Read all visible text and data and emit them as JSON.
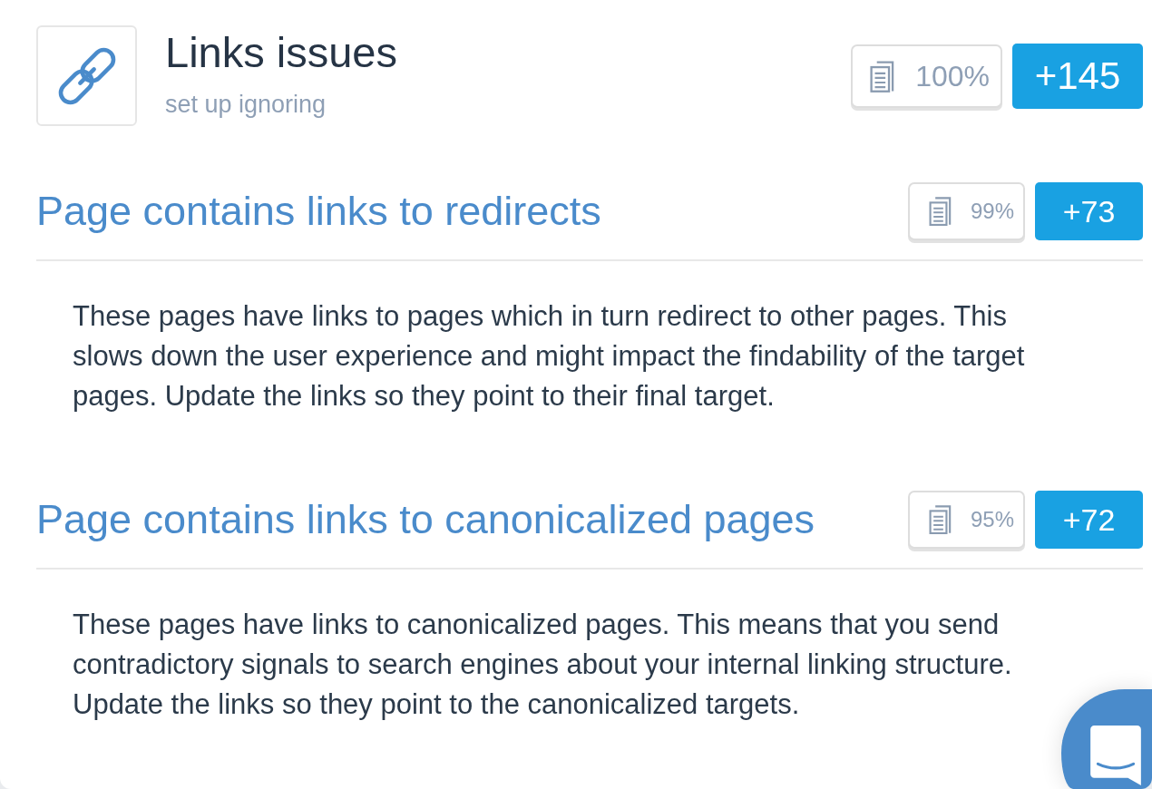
{
  "header": {
    "title": "Links issues",
    "link": "set up ignoring",
    "pages_share": "100%",
    "count": "+145"
  },
  "issues": [
    {
      "title": "Page contains links to redirects",
      "pages_share": "99%",
      "count": "+73",
      "description": "These pages have links to pages which in turn redirect to other pages. This slows down the user experience and might impact the findability of the target pages. Update the links so they point to their final target."
    },
    {
      "title": "Page contains links to canonicalized pages",
      "pages_share": "95%",
      "count": "+72",
      "description": "These pages have links to canonicalized pages. This means that you send contradictory signals to search engines about your internal linking structure. Update the links so they point to the canonicalized targets."
    }
  ]
}
